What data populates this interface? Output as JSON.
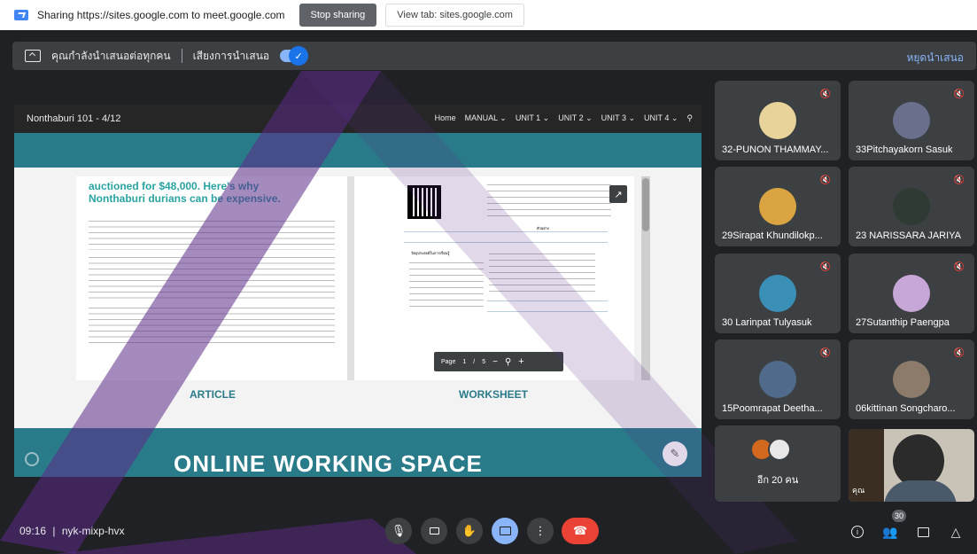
{
  "share_bar": {
    "message": "Sharing https://sites.google.com to meet.google.com",
    "stop_label": "Stop sharing",
    "view_tab_label": "View tab: sites.google.com"
  },
  "presenting_bar": {
    "status": "คุณกำลังนำเสนอต่อทุกคน",
    "audio_label": "เสียงการนำเสนอ",
    "audio_enabled": true,
    "stop_label": "หยุดนำเสนอ"
  },
  "site": {
    "title": "Nonthaburi 101 - 4/12",
    "nav": [
      "Home",
      "MANUAL ⌄",
      "UNIT 1 ⌄",
      "UNIT 2 ⌄",
      "UNIT 3 ⌄",
      "UNIT 4 ⌄"
    ],
    "article": {
      "heading_line1": "auctioned for $48,000. Here's why",
      "heading_line2": "Nonthaburi durians can be expensive.",
      "label": "ARTICLE"
    },
    "worksheet": {
      "label": "WORKSHEET",
      "objectives_title": "วัตถุประสงค์ในการเรียนรู้",
      "example_title": "ตัวอย่าง"
    },
    "pager": {
      "page_label": "Page",
      "current": "1",
      "separator": "/",
      "total": "5"
    },
    "banner_title": "ONLINE WORKING SPACE"
  },
  "participants": [
    {
      "name": "32-PUNON THAMMAY...",
      "muted": true,
      "avatar_color": "#e8d39a"
    },
    {
      "name": "33Pitchayakorn Sasuk",
      "muted": true,
      "avatar_color": "#6a6f8c"
    },
    {
      "name": "29Sirapat Khundilokp...",
      "muted": true,
      "avatar_color": "#d9a441"
    },
    {
      "name": "23 NARISSARA JARIYA",
      "muted": true,
      "avatar_color": "#2e3a33"
    },
    {
      "name": "30 Larinpat Tulyasuk",
      "muted": true,
      "avatar_color": "#3a8fb7"
    },
    {
      "name": "27Sutanthip Paengpa",
      "muted": true,
      "avatar_color": "#c7a6d8"
    },
    {
      "name": "15Poomrapat Deetha...",
      "muted": true,
      "avatar_color": "#4f6a8a"
    },
    {
      "name": "06kittinan Songcharo...",
      "muted": true,
      "avatar_color": "#8c7a6a"
    }
  ],
  "more_participants": {
    "label": "อีก 20 คน"
  },
  "self_view": {
    "label": "คุณ"
  },
  "bottom_bar": {
    "time": "09:16",
    "separator": "|",
    "meeting_code": "nyk-mixp-hvx",
    "participant_count": "30"
  },
  "colors": {
    "accent": "#8ab4f8",
    "end_call": "#ea4335",
    "site_teal": "#2a7b8a",
    "overlay_purple": "#5b2a86"
  }
}
